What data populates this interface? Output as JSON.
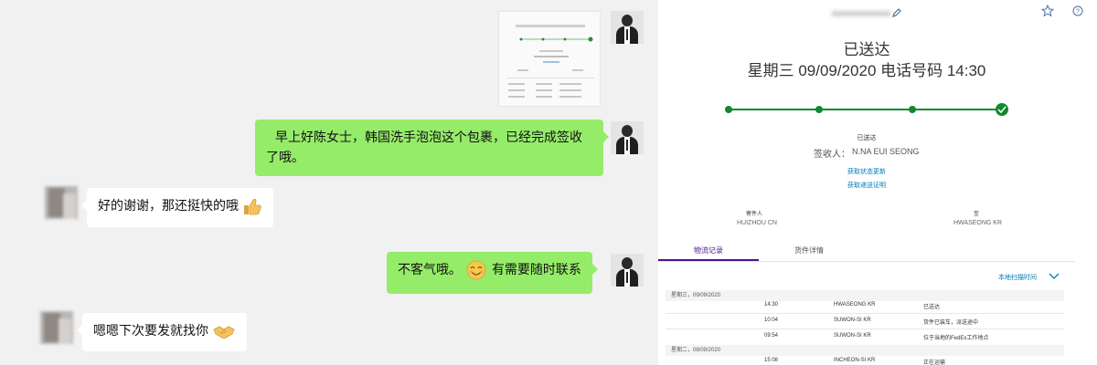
{
  "chat": {
    "messages": [
      {
        "side": "right",
        "text": "早上好陈女士，韩国洗手泡泡这个包裹，已经完成签收了哦。"
      },
      {
        "side": "left",
        "text": "好的谢谢，那还挺快的哦",
        "emoji": "thumbs-up"
      },
      {
        "side": "right",
        "text_before": "不客气哦。",
        "emoji": "smiling-face",
        "text_after": "有需要随时联系"
      },
      {
        "side": "left",
        "text": "嗯嗯下次要发就找你",
        "emoji": "handshake"
      }
    ]
  },
  "tracking": {
    "status": "已送达",
    "delivery_line": "星期三 09/09/2020 电话号码 14:30",
    "progress_steps": 4,
    "completed_steps": 4,
    "status_small": "已送达",
    "receiver_label": "签收人：",
    "receiver_name": "N.NA EUI SEONG",
    "link_status_updates": "获取状态更新",
    "link_proof": "获取递送证明",
    "from_label": "寄件人",
    "from_city": "HUIZHOU CN",
    "to_label": "至",
    "to_city": "HWASEONG KR",
    "tabs": [
      "物流记录",
      "货件详情"
    ],
    "active_tab": 0,
    "local_time_label": "本地扫描时间",
    "history": [
      {
        "date": "星期三，09/09/2020",
        "events": [
          {
            "time": "14:30",
            "location": "HWASEONG KR",
            "event": "已送达"
          },
          {
            "time": "10:04",
            "location": "SUWON-SI KR",
            "event": "货件已装车，派送途中"
          },
          {
            "time": "09:54",
            "location": "SUWON-SI KR",
            "event": "位于当地的FedEx工作地点"
          }
        ]
      },
      {
        "date": "星期二，08/09/2020",
        "events": [
          {
            "time": "15:08",
            "location": "INCHEON-SI KR",
            "event": "正在运输"
          }
        ]
      }
    ],
    "accent_color": "#4d148c",
    "progress_color": "#118a2d",
    "link_color": "#007ab7"
  }
}
